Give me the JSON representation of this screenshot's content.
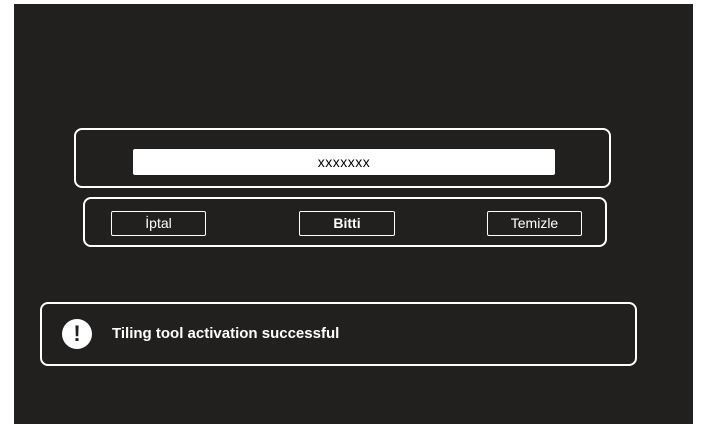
{
  "input": {
    "value": "xxxxxxx"
  },
  "buttons": {
    "cancel_label": "İptal",
    "done_label": "Bitti",
    "clear_label": "Temizle"
  },
  "message": {
    "icon": "exclamation-icon",
    "text": "Tiling tool activation successful"
  },
  "colors": {
    "background": "#221f1f",
    "foreground": "#ffffff",
    "field_background": "#ffffff"
  }
}
